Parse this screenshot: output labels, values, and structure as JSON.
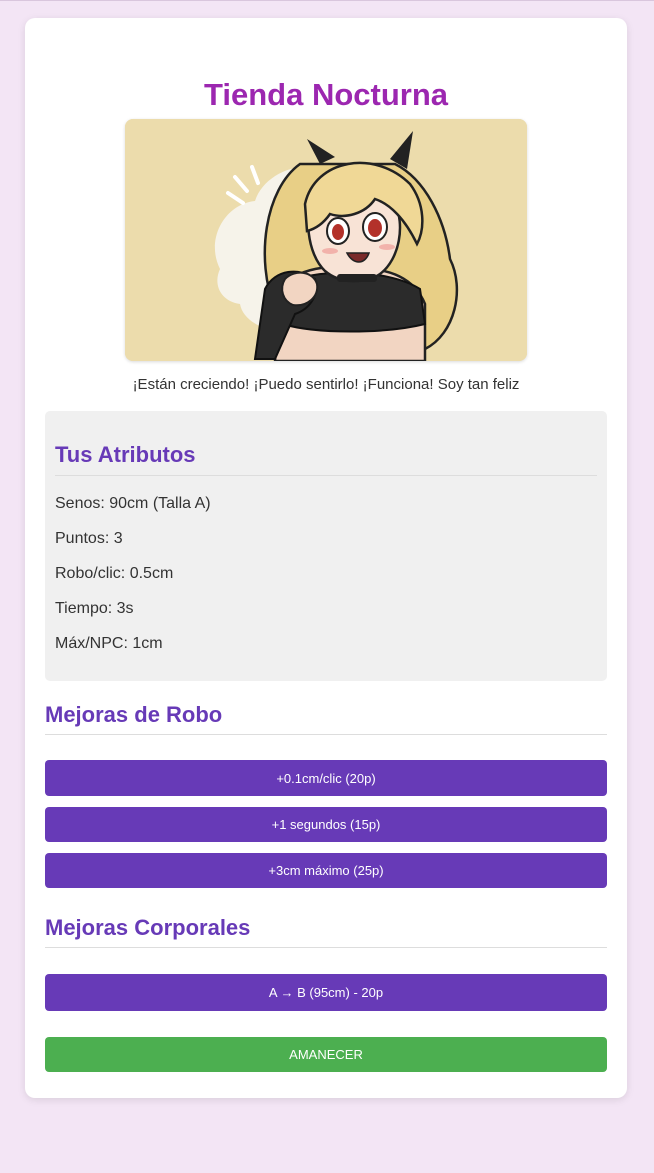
{
  "shop": {
    "title": "Tienda Nocturna",
    "dialogue": "¡Están creciendo! ¡Puedo sentirlo! ¡Funciona! Soy tan feliz",
    "portrait_icon": "anime-girl-portrait"
  },
  "attributes": {
    "heading": "Tus Atributos",
    "lines": [
      "Senos: 90cm (Talla A)",
      "Puntos: 3",
      "Robo/clic: 0.5cm",
      "Tiempo: 3s",
      "Máx/NPC: 1cm"
    ]
  },
  "steal_upgrades": {
    "heading": "Mejoras de Robo",
    "buttons": [
      "+0.1cm/clic (20p)",
      "+1 segundos (15p)",
      "+3cm máximo (25p)"
    ]
  },
  "body_upgrades": {
    "heading": "Mejoras Corporales",
    "buttons": [
      "A → B (95cm) - 20p"
    ]
  },
  "dawn_button": "AMANECER",
  "colors": {
    "background": "#f3e5f5",
    "title": "#9c27b0",
    "heading": "#673ab7",
    "button": "#673ab7",
    "dawn_button": "#4caf50",
    "stats_panel": "#f0f0f0"
  }
}
